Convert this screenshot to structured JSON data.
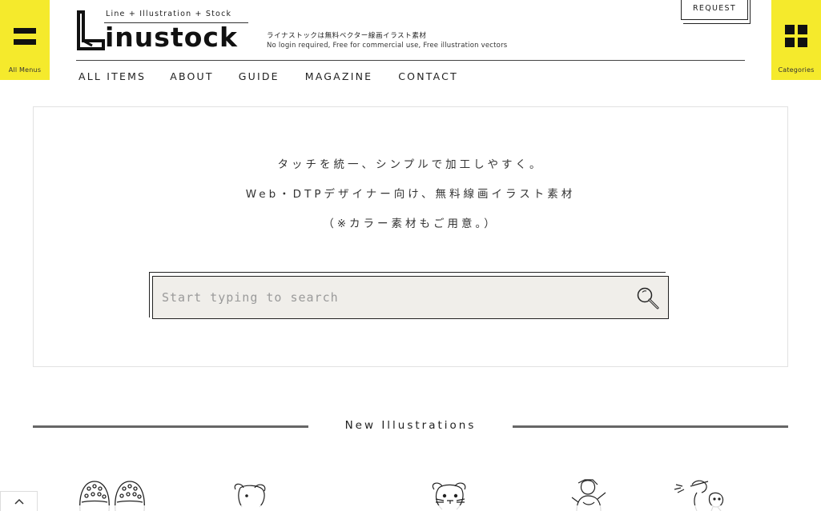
{
  "corner_left": {
    "label": "All Menus",
    "icon": "hamburger-icon"
  },
  "corner_right": {
    "label": "Categories",
    "icon": "grid-icon"
  },
  "logo": {
    "tagline": "Line + Illustration + Stock",
    "name": "inustock",
    "desc_jp": "ライナストックは無料ベクター線画イラスト素材",
    "desc_en": "No login required, Free for commercial use, Free illustration vectors"
  },
  "request_label": "REQUEST",
  "nav": [
    "ALL ITEMS",
    "ABOUT",
    "GUIDE",
    "MAGAZINE",
    "CONTACT"
  ],
  "hero": {
    "line1": "タッチを統一、シンプルで加工しやすく。",
    "line2": "Web・DTPデザイナー向け、無料線画イラスト素材",
    "line3": "（※カラー素材もご用意。）"
  },
  "search": {
    "placeholder": "Start typing to search",
    "icon": "search-icon"
  },
  "section_title": "New Illustrations",
  "thumbnails": [
    "shoes-illustration",
    "mouse-illustration",
    "mouse-illustration",
    "person-illustration",
    "person-illustration"
  ],
  "scroll_top_icon": "chevron-up-icon",
  "colors": {
    "accent_yellow": "#f5ea2c",
    "search_bg": "#f0eeea",
    "text": "#222222"
  }
}
